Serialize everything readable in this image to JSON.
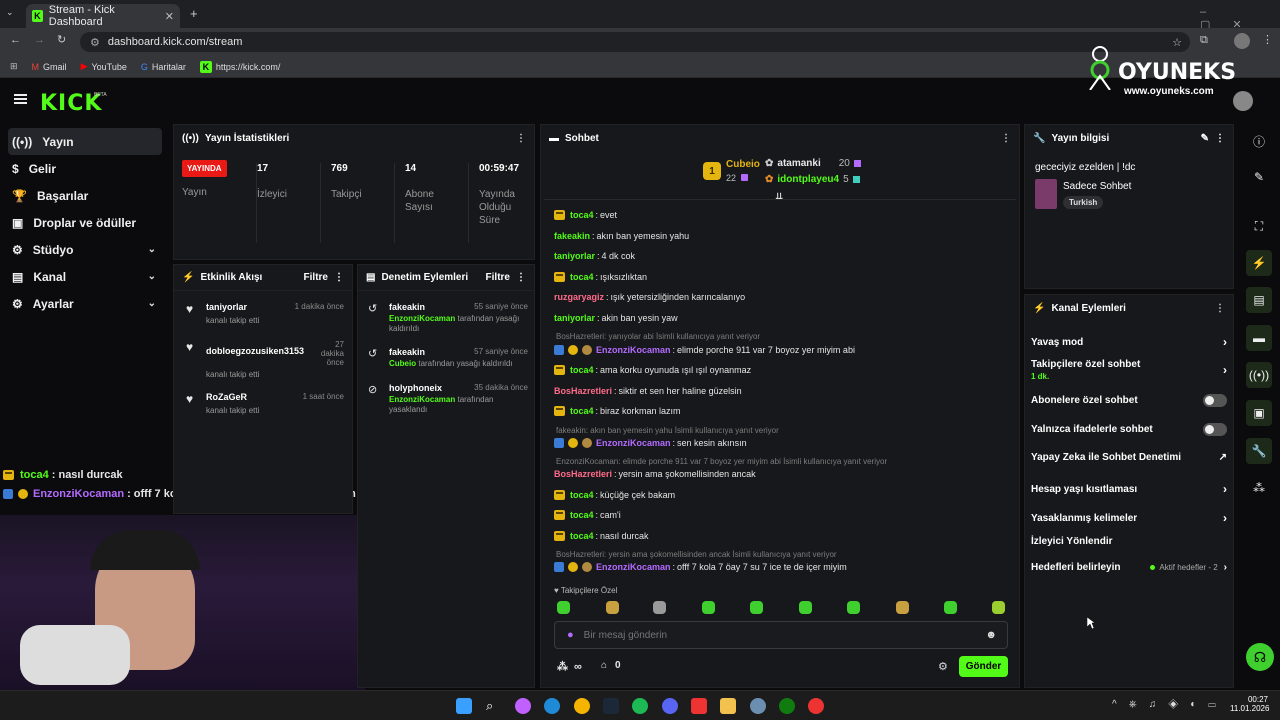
{
  "browser": {
    "tab_title": "Stream - Kick Dashboard",
    "url": "dashboard.kick.com/stream",
    "bookmarks": [
      "Gmail",
      "YouTube",
      "Haritalar",
      "https://kick.com/"
    ]
  },
  "brand": {
    "logo": "KICK",
    "beta": "BETA",
    "watermark": "OYUNEKS",
    "watermark_url": "www.oyuneks.com"
  },
  "sidebar": {
    "items": [
      {
        "label": "Yayın",
        "icon": "broadcast-icon"
      },
      {
        "label": "Gelir",
        "icon": "dollar-icon"
      },
      {
        "label": "Başarılar",
        "icon": "trophy-icon"
      },
      {
        "label": "Droplar ve ödüller",
        "icon": "gift-icon"
      },
      {
        "label": "Stüdyo",
        "icon": "studio-icon"
      },
      {
        "label": "Kanal",
        "icon": "channel-icon"
      },
      {
        "label": "Ayarlar",
        "icon": "gear-icon"
      }
    ]
  },
  "stats": {
    "title": "Yayın İstatistikleri",
    "live_badge": "YAYINDA",
    "live_label": "Yayın",
    "cols": [
      {
        "v": "17",
        "l": "İzleyici"
      },
      {
        "v": "769",
        "l": "Takipçi"
      },
      {
        "v": "14",
        "l": "Abone Sayısı"
      },
      {
        "v": "00:59:47",
        "l": "Yayında Olduğu Süre"
      }
    ]
  },
  "activity": {
    "title": "Etkinlik Akışı",
    "filter": "Filtre",
    "items": [
      {
        "name": "taniyorlar",
        "sub": "kanalı takip etti",
        "time": "1 dakika önce"
      },
      {
        "name": "dobloegzozusiken3153",
        "sub": "kanalı takip etti",
        "time": "27 dakika önce"
      },
      {
        "name": "RoZaGeR",
        "sub": "kanalı takip etti",
        "time": "1 saat önce"
      }
    ]
  },
  "moderation": {
    "title": "Denetim Eylemleri",
    "filter": "Filtre",
    "items": [
      {
        "name": "fakeakin",
        "time": "55 saniye önce",
        "mod": "EnzonziKocaman",
        "rest": "tarafından yasağı kaldırıldı"
      },
      {
        "name": "fakeakin",
        "time": "57 saniye önce",
        "mod": "Cubeio",
        "rest": "tarafından yasağı kaldırıldı"
      },
      {
        "name": "holyphoneix",
        "time": "35 dakika önce",
        "mod": "EnzonziKocaman",
        "rest": "tarafından yasaklandı"
      }
    ]
  },
  "chat": {
    "title": "Sohbet",
    "top": [
      {
        "name": "Cubeio",
        "count": "22"
      },
      {
        "name": "atamanki",
        "count": "20"
      },
      {
        "name": "idontplayeu4",
        "count": "5"
      }
    ],
    "rank": "1",
    "messages": [
      {
        "type": "msg",
        "user": "toca4",
        "cls": "green",
        "crown": true,
        "text": "evet"
      },
      {
        "type": "msg",
        "user": "fakeakin",
        "cls": "green",
        "text": "akın ban yemesin yahu"
      },
      {
        "type": "msg",
        "user": "taniyorlar",
        "cls": "green",
        "text": "4 dk cok"
      },
      {
        "type": "msg",
        "user": "toca4",
        "cls": "green",
        "crown": true,
        "text": "ışıksızlıktan"
      },
      {
        "type": "msg",
        "user": "ruzgaryagiz",
        "cls": "pink",
        "text": "ışık yetersizliğinden karıncalanıyo"
      },
      {
        "type": "msg",
        "user": "taniyorlar",
        "cls": "green",
        "text": "akin ban yesin yaw"
      },
      {
        "type": "reply",
        "text": "BosHazretleri: yanıyolar abi İsimli kullanıcıya yanıt veriyor"
      },
      {
        "type": "msg",
        "user": "EnzonziKocaman",
        "cls": "purple",
        "badges": true,
        "text": "elimde porche 911 var 7 boyoz yer miyim abi"
      },
      {
        "type": "msg",
        "user": "toca4",
        "cls": "green",
        "crown": true,
        "text": "ama korku oyunuda ışıl ışıl oynanmaz"
      },
      {
        "type": "msg",
        "user": "BosHazretleri",
        "cls": "pink",
        "text": "siktir et sen her haline güzelsin"
      },
      {
        "type": "msg",
        "user": "toca4",
        "cls": "green",
        "crown": true,
        "text": "biraz korkman lazım"
      },
      {
        "type": "reply",
        "text": "fakeakin: akın ban yemesin yahu İsimli kullanıcıya yanıt veriyor"
      },
      {
        "type": "msg",
        "user": "EnzonziKocaman",
        "cls": "purple",
        "badges": true,
        "text": "sen kesin akınsın"
      },
      {
        "type": "reply",
        "text": "EnzonziKocaman: elimde porche 911 var 7 boyoz yer miyim abi İsimli kullanıcıya yanıt veriyor"
      },
      {
        "type": "msg",
        "user": "BosHazretleri",
        "cls": "pink",
        "text": "yersin ama şokomellisinden ancak"
      },
      {
        "type": "msg",
        "user": "toca4",
        "cls": "green",
        "crown": true,
        "text": "küçüğe çek bakam"
      },
      {
        "type": "msg",
        "user": "toca4",
        "cls": "green",
        "crown": true,
        "text": "cam'i"
      },
      {
        "type": "msg",
        "user": "toca4",
        "cls": "green",
        "crown": true,
        "text": "nasıl durcak"
      },
      {
        "type": "reply",
        "text": "BosHazretleri: yersin ama şokomellisinden ancak İsimli kullanıcıya yanıt veriyor"
      },
      {
        "type": "msg",
        "user": "EnzonziKocaman",
        "cls": "purple",
        "badges": true,
        "text": "offf 7 kola 7 öay 7 su 7 ice te de içer miyim"
      }
    ],
    "followers_label": "Takipçilere Özel",
    "input_placeholder": "Bir mesaj gönderin",
    "points": "∞",
    "shop_count": "0",
    "send": "Gönder"
  },
  "overlay_chat": [
    {
      "user": "toca4",
      "text": ": nasıl durcak"
    },
    {
      "user": "EnzonziKocaman",
      "text": ": offf 7 kola 7 öay 7 su 7 ice te de içer miyim"
    }
  ],
  "stream_info": {
    "title": "Yayın bilgisi",
    "stream_title": "gececiyiz ezelden | !dc",
    "category": "Sadece Sohbet",
    "tag": "Turkish"
  },
  "channel_actions": {
    "title": "Kanal Eylemleri",
    "rows": [
      {
        "label": "Yavaş mod",
        "kind": "arrow"
      },
      {
        "label": "Takipçilere özel sohbet",
        "sub": "1 dk.",
        "kind": "arrow"
      },
      {
        "label": "Abonelere özel sohbet",
        "kind": "toggle"
      },
      {
        "label": "Yalnızca ifadelerle sohbet",
        "kind": "toggle"
      },
      {
        "label": "Yapay Zeka ile Sohbet Denetimi",
        "kind": "ext"
      },
      {
        "label": "Hesap yaşı kısıtlaması",
        "kind": "arrow"
      },
      {
        "label": "Yasaklanmış kelimeler",
        "kind": "arrow"
      },
      {
        "label": "İzleyici Yönlendir",
        "kind": "none"
      },
      {
        "label": "Hedefleri belirleyin",
        "extra": "Aktif hedefler - 2",
        "kind": "arrow"
      }
    ]
  },
  "taskbar": {
    "time": "00:27",
    "date": "11.01.2026"
  }
}
